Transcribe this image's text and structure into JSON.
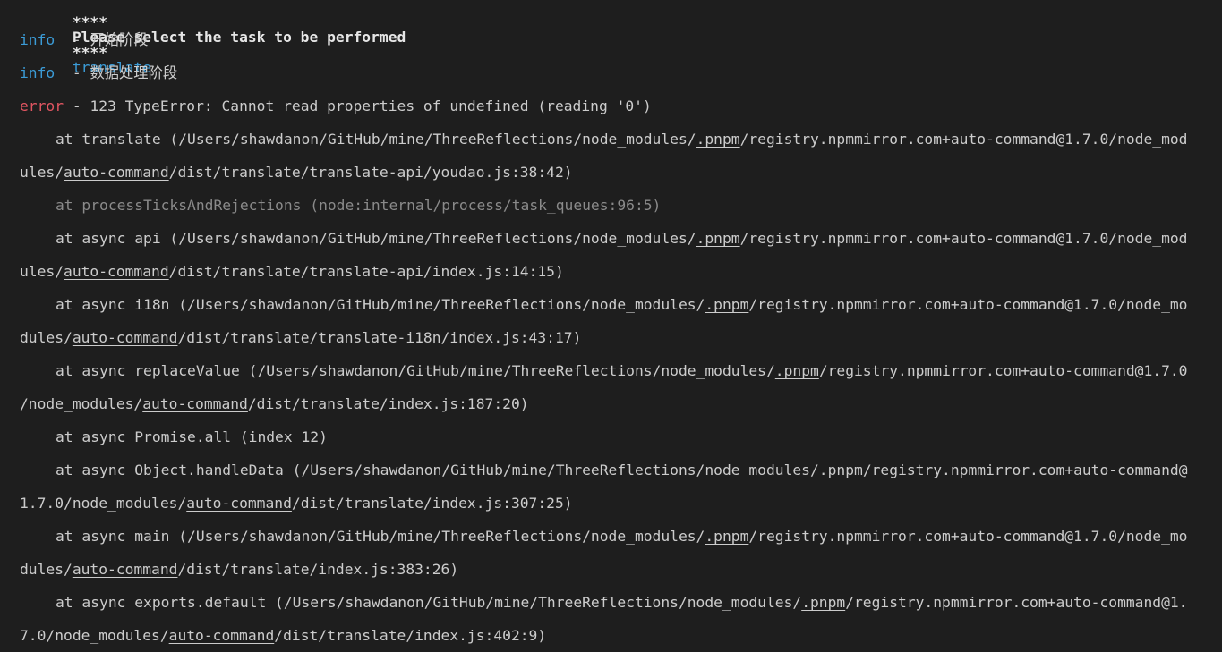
{
  "terminal": {
    "prompt_stars_left": "****",
    "prompt_text": "Please select the task to be performed",
    "prompt_stars_right": "****",
    "prompt_answer": "translate",
    "log": [
      {
        "level": "info",
        "sep": " - ",
        "msg": "开始阶段"
      },
      {
        "level": "info",
        "sep": " - ",
        "msg": "数据处理阶段"
      }
    ],
    "error": {
      "level": "error",
      "sep": " - ",
      "msg": "123 TypeError: Cannot read properties of undefined (reading '0')"
    },
    "stack": [
      {
        "l1_pre": "at translate (/Users/shawdanon/GitHub/mine/ThreeReflections/node_modules/",
        "l1_pnpm": ".pnpm",
        "l1_post": "/registry.npmmirror.com+auto-command@1.7.0/node_mod",
        "l2_pre": "ules/",
        "l2_link": "auto-command",
        "l2_post": "/dist/translate/translate-api/youdao.js:38:42)"
      },
      {
        "l1_dim": "at processTicksAndRejections (node:internal/process/task_queues:96:5)"
      },
      {
        "l1_pre": "at async api (/Users/shawdanon/GitHub/mine/ThreeReflections/node_modules/",
        "l1_pnpm": ".pnpm",
        "l1_post": "/registry.npmmirror.com+auto-command@1.7.0/node_mod",
        "l2_pre": "ules/",
        "l2_link": "auto-command",
        "l2_post": "/dist/translate/translate-api/index.js:14:15)"
      },
      {
        "l1_pre": "at async i18n (/Users/shawdanon/GitHub/mine/ThreeReflections/node_modules/",
        "l1_pnpm": ".pnpm",
        "l1_post": "/registry.npmmirror.com+auto-command@1.7.0/node_mo",
        "l2_pre": "dules/",
        "l2_link": "auto-command",
        "l2_post": "/dist/translate/translate-i18n/index.js:43:17)"
      },
      {
        "l1_pre": "at async replaceValue (/Users/shawdanon/GitHub/mine/ThreeReflections/node_modules/",
        "l1_pnpm": ".pnpm",
        "l1_post": "/registry.npmmirror.com+auto-command@1.7.0",
        "l2_pre": "/node_modules/",
        "l2_link": "auto-command",
        "l2_post": "/dist/translate/index.js:187:20)"
      },
      {
        "l1_plain": "at async Promise.all (index 12)"
      },
      {
        "l1_pre": "at async Object.handleData (/Users/shawdanon/GitHub/mine/ThreeReflections/node_modules/",
        "l1_pnpm": ".pnpm",
        "l1_post": "/registry.npmmirror.com+auto-command@",
        "l2_pre": "1.7.0/node_modules/",
        "l2_link": "auto-command",
        "l2_post": "/dist/translate/index.js:307:25)"
      },
      {
        "l1_pre": "at async main (/Users/shawdanon/GitHub/mine/ThreeReflections/node_modules/",
        "l1_pnpm": ".pnpm",
        "l1_post": "/registry.npmmirror.com+auto-command@1.7.0/node_mo",
        "l2_pre": "dules/",
        "l2_link": "auto-command",
        "l2_post": "/dist/translate/index.js:383:26)"
      },
      {
        "l1_pre": "at async exports.default (/Users/shawdanon/GitHub/mine/ThreeReflections/node_modules/",
        "l1_pnpm": ".pnpm",
        "l1_post": "/registry.npmmirror.com+auto-command@1.",
        "l2_pre": "7.0/node_modules/",
        "l2_link": "auto-command",
        "l2_post": "/dist/translate/index.js:402:9)"
      }
    ],
    "colors": {
      "background": "#1e1e1e",
      "text": "#cccccc",
      "info": "#3b9bd6",
      "error": "#e05561",
      "dim": "#8a8a8a"
    }
  }
}
